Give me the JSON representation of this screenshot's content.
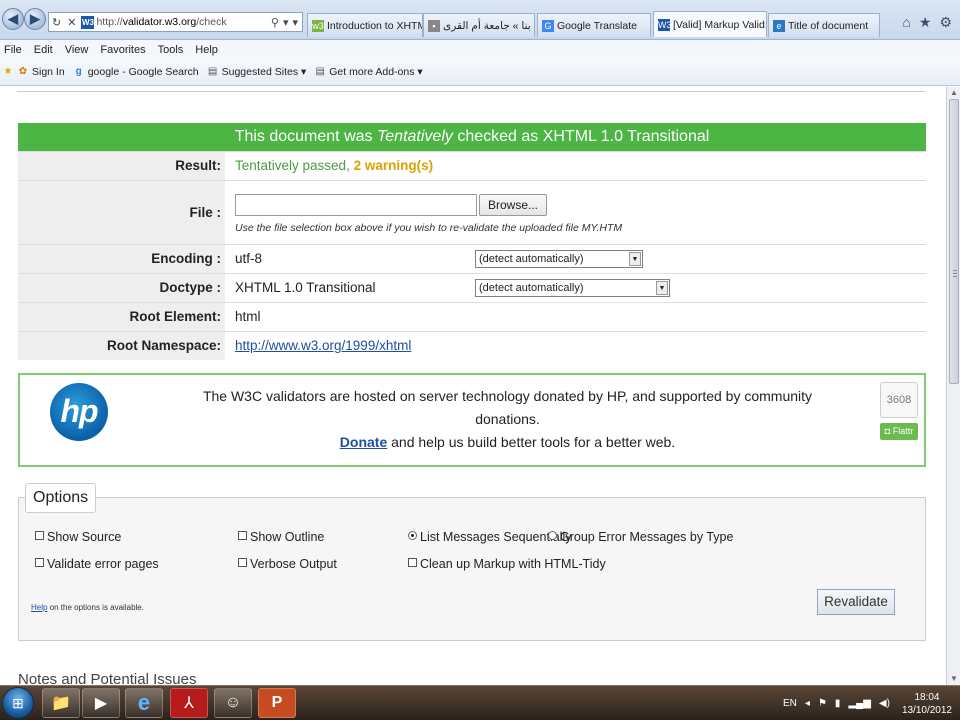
{
  "browser": {
    "address": {
      "url_prefix": "http://",
      "url_host": "validator.w3.org",
      "url_path": "/check"
    },
    "tabs": [
      {
        "label": "Introduction to XHTML",
        "icon": "w3c-icon"
      },
      {
        "label": "اتصل بنا » جامعة أم القرى",
        "icon": "page-icon"
      },
      {
        "label": "Google Translate",
        "icon": "translate-icon"
      },
      {
        "label": "[Valid] Markup Valid...",
        "icon": "w3c-icon",
        "active": true
      },
      {
        "label": "Title of document",
        "icon": "ie-icon"
      }
    ],
    "menu": [
      "File",
      "Edit",
      "View",
      "Favorites",
      "Tools",
      "Help"
    ],
    "favorites": [
      {
        "label": "Sign In",
        "icon": "msn-icon"
      },
      {
        "label": "google - Google Search",
        "icon": "google-icon"
      },
      {
        "label": "Suggested Sites ▾",
        "icon": "page-icon"
      },
      {
        "label": "Get more Add-ons ▾",
        "icon": "page-icon"
      }
    ]
  },
  "result": {
    "banner_prefix": "This document was ",
    "banner_emph": "Tentatively",
    "banner_suffix": " checked as XHTML 1.0 Transitional",
    "rows": {
      "result_label": "Result:",
      "result_pass": "Tentatively passed,",
      "result_warn": "2 warning(s)",
      "file_label": "File :",
      "browse": "Browse...",
      "file_hint": "Use the file selection box above if you wish to re-validate the uploaded file MY.HTM",
      "encoding_label": "Encoding :",
      "encoding_value": "utf-8",
      "encoding_select": "(detect automatically)",
      "doctype_label": "Doctype :",
      "doctype_value": "XHTML 1.0 Transitional",
      "doctype_select": "(detect automatically)",
      "root_label": "Root Element:",
      "root_value": "html",
      "ns_label": "Root Namespace:",
      "ns_value": "http://www.w3.org/1999/xhtml"
    }
  },
  "donate": {
    "logo": "hp",
    "line1": "The W3C validators are hosted on server technology donated by HP, and supported by community donations.",
    "donate_link": "Donate",
    "line2_rest": " and help us build better tools for a better web.",
    "count": "3608",
    "flattr": "Flattr"
  },
  "options": {
    "legend": "Options",
    "show_source": "Show Source",
    "show_outline": "Show Outline",
    "list_sequential": "List Messages Sequentially",
    "group_by_type": "Group Error Messages by Type",
    "validate_error_pages": "Validate error pages",
    "verbose_output": "Verbose Output",
    "cleanup_tidy": "Clean up Markup with HTML-Tidy",
    "help_link": "Help",
    "help_rest": " on the options is available.",
    "revalidate": "Revalidate"
  },
  "notes_heading": "Notes and Potential Issues",
  "taskbar": {
    "lang": "EN",
    "time": "18:04",
    "date": "13/10/2012",
    "apps": [
      "explorer-icon",
      "media-player-icon",
      "ie-icon",
      "acrobat-icon",
      "messenger-icon",
      "powerpoint-icon"
    ]
  },
  "colors": {
    "valid_green": "#4cb544",
    "warn_yellow": "#d8a300",
    "link_blue": "#1e4fa3"
  }
}
